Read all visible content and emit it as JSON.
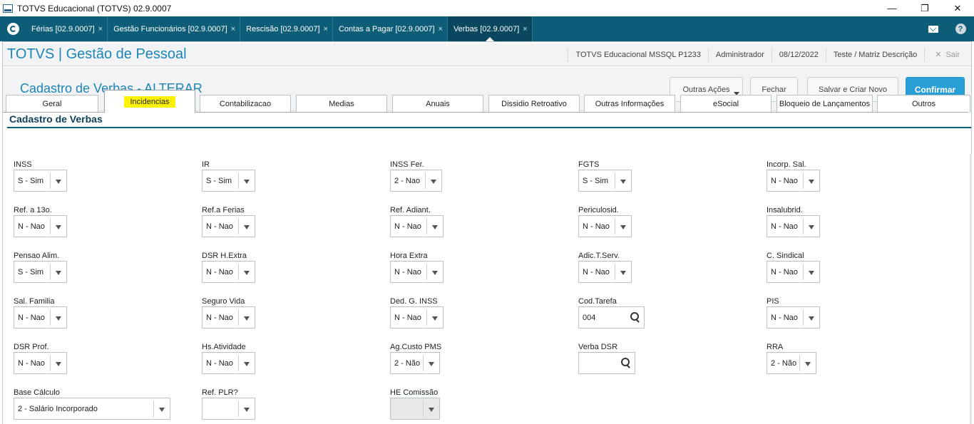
{
  "window": {
    "title": "TOTVS Educacional (TOTVS) 02.9.0007"
  },
  "app_tabs": [
    {
      "label": "Férias [02.9.0007]"
    },
    {
      "label": "Gestão Funcionários [02.9.0007]"
    },
    {
      "label": "Rescisão [02.9.0007]"
    },
    {
      "label": "Contas a Pagar [02.9.0007]"
    },
    {
      "label": "Verbas [02.9.0007]"
    }
  ],
  "tab_close_glyph": "×",
  "header": {
    "brand": "TOTVS | Gestão de Pessoal",
    "database": "TOTVS Educacional MSSQL P1233",
    "user": "Administrador",
    "date": "08/12/2022",
    "branch": "Teste / Matriz Descrição",
    "exit_label": "Sair"
  },
  "page": {
    "title": "Cadastro de Verbas - ALTERAR",
    "actions": {
      "other": "Outras Ações",
      "close": "Fechar",
      "save_new": "Salvar e Criar Novo",
      "confirm": "Confirmar"
    },
    "section_title": "Cadastro de Verbas"
  },
  "form_tabs": [
    "Geral",
    "Incidencias",
    "Contabilizacao",
    "Medias",
    "Anuais",
    "Dissidio Retroativo",
    "Outras Informações",
    "eSocial",
    "Bloqueio de Lançamentos",
    "Outros"
  ],
  "active_tab": "Incidencias",
  "fields": {
    "inss": {
      "label": "INSS",
      "value": "S - Sim"
    },
    "ir": {
      "label": "IR",
      "value": "S - Sim"
    },
    "inss_fer": {
      "label": "INSS Fer.",
      "value": "2 - Nao"
    },
    "fgts": {
      "label": "FGTS",
      "value": "S - Sim"
    },
    "incorp_sal": {
      "label": "Incorp. Sal.",
      "value": "N - Nao"
    },
    "ref_13o": {
      "label": "Ref. a 13o.",
      "value": "N - Nao"
    },
    "ref_ferias": {
      "label": "Ref.a Ferias",
      "value": "N - Nao"
    },
    "ref_adiant": {
      "label": "Ref. Adiant.",
      "value": "N - Nao"
    },
    "periculosid": {
      "label": "Periculosid.",
      "value": "N - Nao"
    },
    "insalubrid": {
      "label": "Insalubrid.",
      "value": "N - Nao"
    },
    "pensao_alim": {
      "label": "Pensao Alim.",
      "value": "S - Sim"
    },
    "dsr_hextra": {
      "label": "DSR H.Extra",
      "value": "N - Nao"
    },
    "hora_extra": {
      "label": "Hora Extra",
      "value": "N - Nao"
    },
    "adic_tserv": {
      "label": "Adic.T.Serv.",
      "value": "N - Nao"
    },
    "c_sindical": {
      "label": "C. Sindical",
      "value": "N - Nao"
    },
    "sal_familia": {
      "label": "Sal. Familia",
      "value": "N - Nao"
    },
    "seguro_vida": {
      "label": "Seguro Vida",
      "value": "N - Nao"
    },
    "ded_g_inss": {
      "label": "Ded. G. INSS",
      "value": "N - Nao"
    },
    "cod_tarefa": {
      "label": "Cod.Tarefa",
      "value": "004"
    },
    "pis": {
      "label": "PIS",
      "value": "N - Nao"
    },
    "dsr_prof": {
      "label": "DSR Prof.",
      "value": "N - Nao"
    },
    "hs_atividade": {
      "label": "Hs.Atividade",
      "value": "N - Nao"
    },
    "ag_custo_pms": {
      "label": "Ag.Custo PMS",
      "value": "2 - Não"
    },
    "verba_dsr": {
      "label": "Verba DSR",
      "value": ""
    },
    "rra": {
      "label": "RRA",
      "value": "2 - Não"
    },
    "base_calculo": {
      "label": "Base Cálculo",
      "value": "2 - Salário Incorporado"
    },
    "ref_plr": {
      "label": "Ref. PLR?",
      "value": ""
    },
    "he_comissao": {
      "label": "HE Comissão",
      "value": ""
    }
  },
  "colors": {
    "tabbar": "#0e5d78",
    "accent": "#1d85b6",
    "primary_button": "#2a9fd6",
    "highlight": "#fff200"
  }
}
